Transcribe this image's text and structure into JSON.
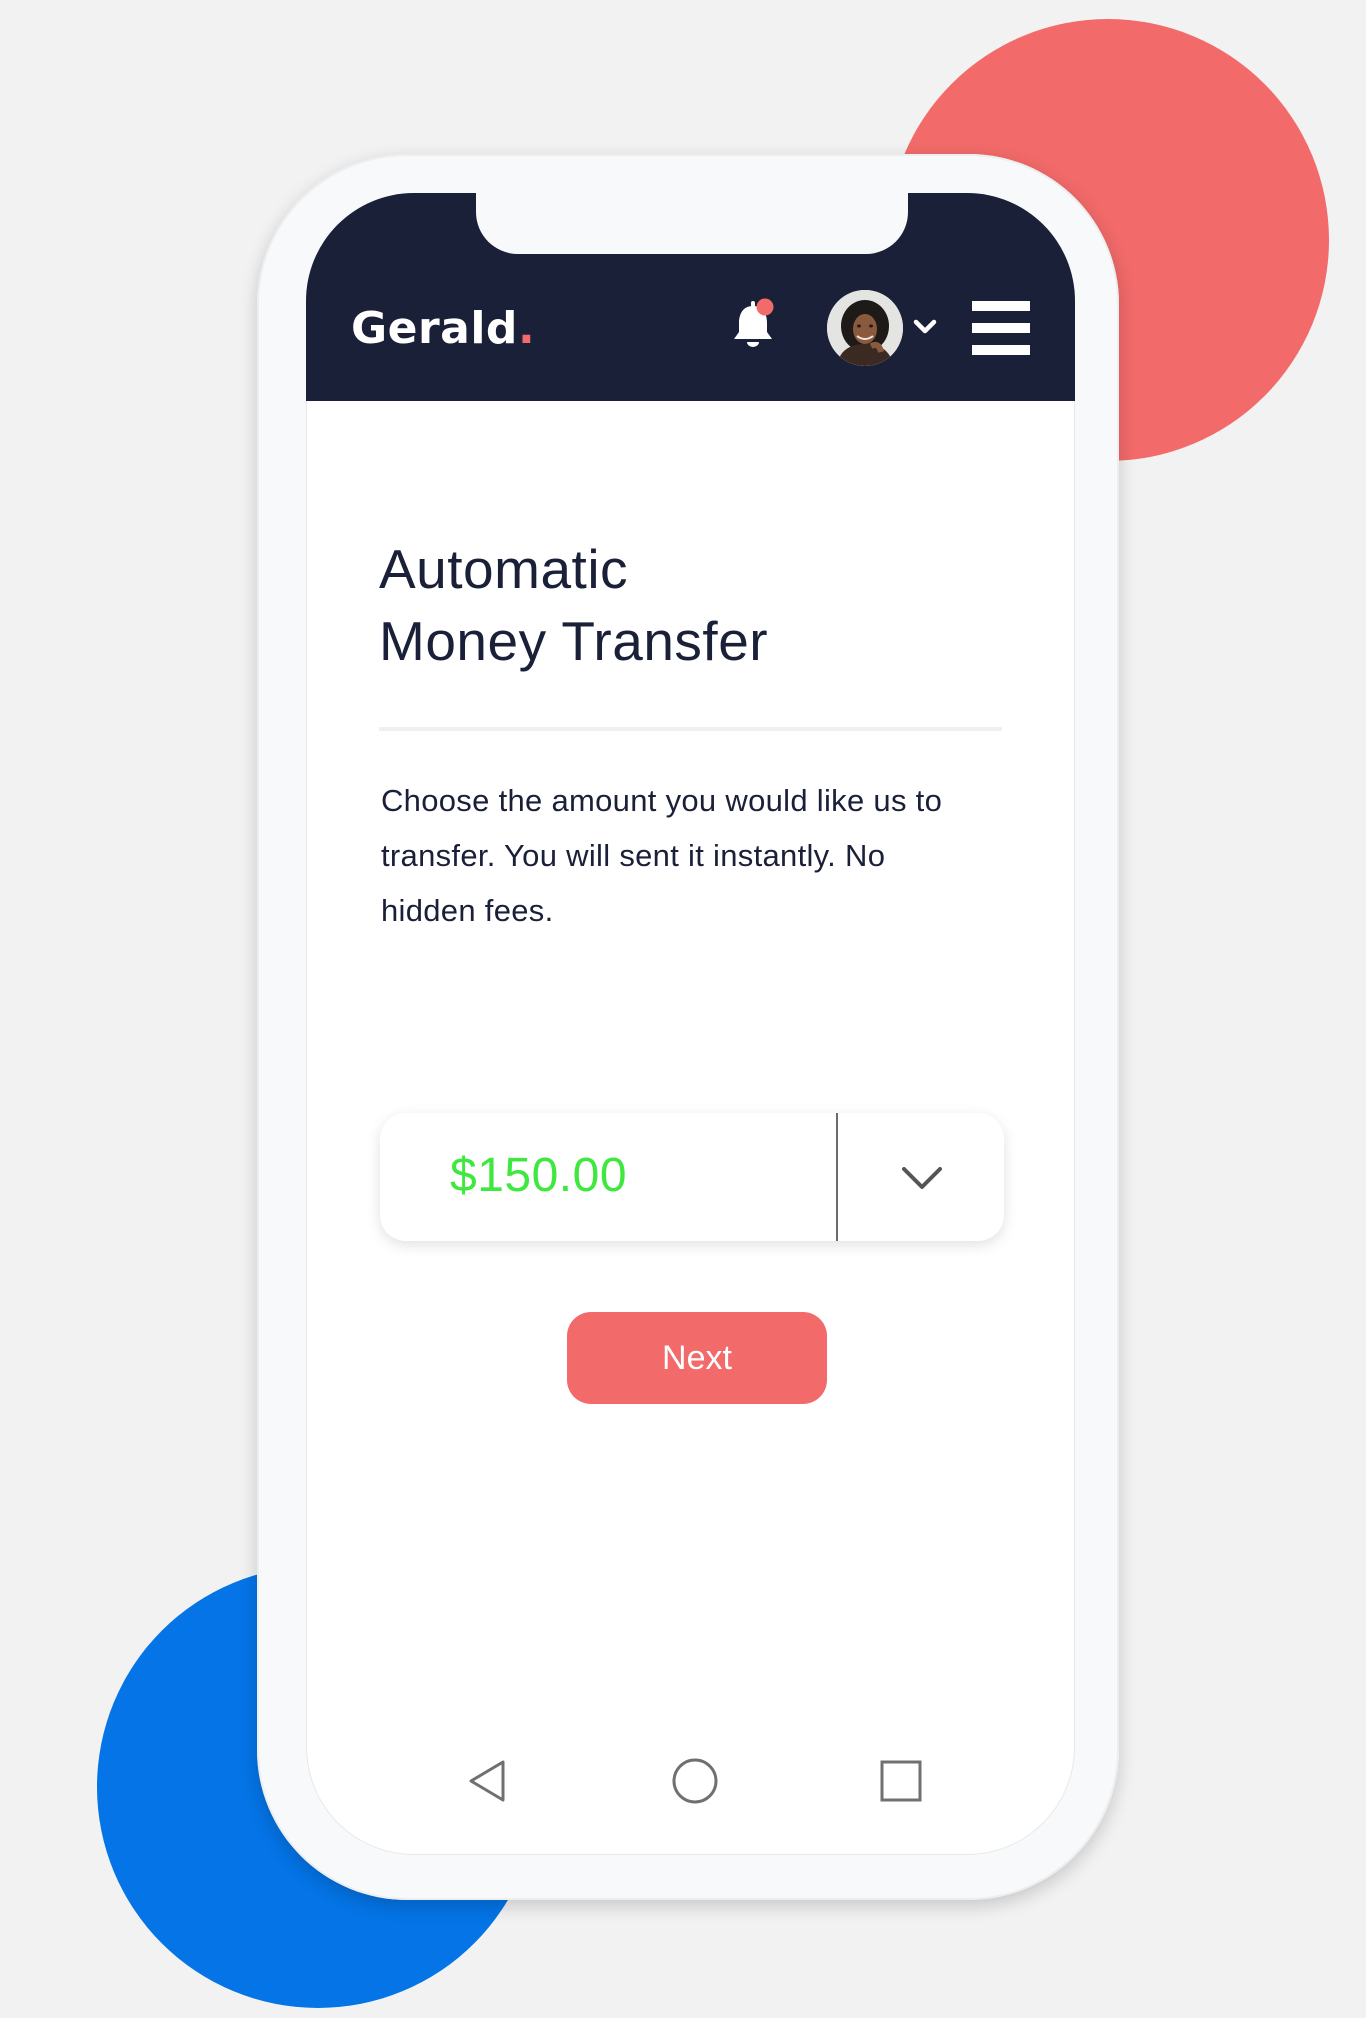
{
  "header": {
    "logo_text": "Gerald",
    "logo_dot": ".",
    "notification_icon": "bell-icon",
    "notification_badge_color": "#f26a6a",
    "avatar_icon": "user-avatar",
    "dropdown_icon": "chevron-down-icon",
    "menu_icon": "hamburger-menu-icon",
    "background_color": "#1b2039"
  },
  "main": {
    "title_line1": "Automatic",
    "title_line2": "Money Transfer",
    "description": "Choose the amount you would like us to transfer. You will sent it instantly. No hidden fees.",
    "amount_value": "$150.00",
    "amount_color": "#3ee83e",
    "amount_dropdown_icon": "chevron-down-icon",
    "next_label": "Next",
    "accent_color": "#f26a6a"
  },
  "nav": {
    "back_icon": "back-triangle-icon",
    "home_icon": "home-circle-icon",
    "recent_icon": "recent-apps-square-icon"
  },
  "decor": {
    "circle_top_color": "#f26a6a",
    "circle_bottom_color": "#0474e6"
  }
}
